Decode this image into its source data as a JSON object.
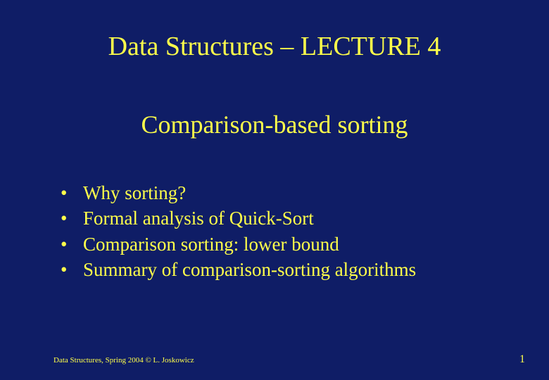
{
  "title": "Data Structures – LECTURE 4",
  "subtitle": "Comparison-based sorting",
  "bullets": [
    "Why sorting?",
    "Formal analysis of Quick-Sort",
    "Comparison sorting: lower bound",
    "Summary of comparison-sorting algorithms"
  ],
  "footer": "Data Structures, Spring 2004 © L. Joskowicz",
  "pageNumber": "1"
}
